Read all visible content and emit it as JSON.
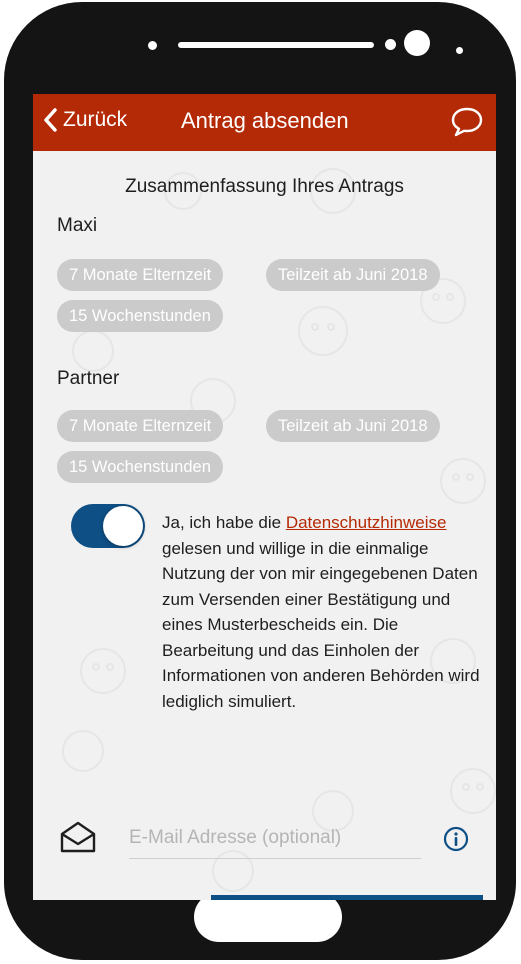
{
  "header": {
    "back_label": "Zurück",
    "title": "Antrag absenden"
  },
  "summary": {
    "title": "Zusammenfassung Ihres Antrags",
    "persons": [
      {
        "name": "Maxi",
        "chips": [
          "7 Monate Elternzeit",
          "Teilzeit ab Juni 2018",
          "15 Wochenstunden"
        ]
      },
      {
        "name": "Partner",
        "chips": [
          "7 Monate Elternzeit",
          "Teilzeit ab Juni 2018",
          "15 Wochenstunden"
        ]
      }
    ]
  },
  "consent": {
    "toggle_on": true,
    "text_before_link": "Ja, ich habe die ",
    "link_text": "Datenschutzhinweise",
    "text_after_link": " gelesen und willige in die einmalige Nutzung der von mir eingegebenen Daten zum Versenden einer Bestätigung und eines Musterbescheids ein. Die Bearbeitung und das Einholen der Informationen von anderen Behörden wird lediglich simuliert."
  },
  "email": {
    "placeholder": "E-Mail Adresse (optional)",
    "value": ""
  },
  "icons": {
    "back": "chevron-left-icon",
    "chat": "chat-bubble-icon",
    "mail": "envelope-open-icon",
    "info": "info-icon"
  },
  "colors": {
    "appbar": "#b52a06",
    "toggle": "#0e4f85",
    "chip": "#cbcbcb",
    "link": "#b52a06",
    "background": "#f1f1f1"
  }
}
